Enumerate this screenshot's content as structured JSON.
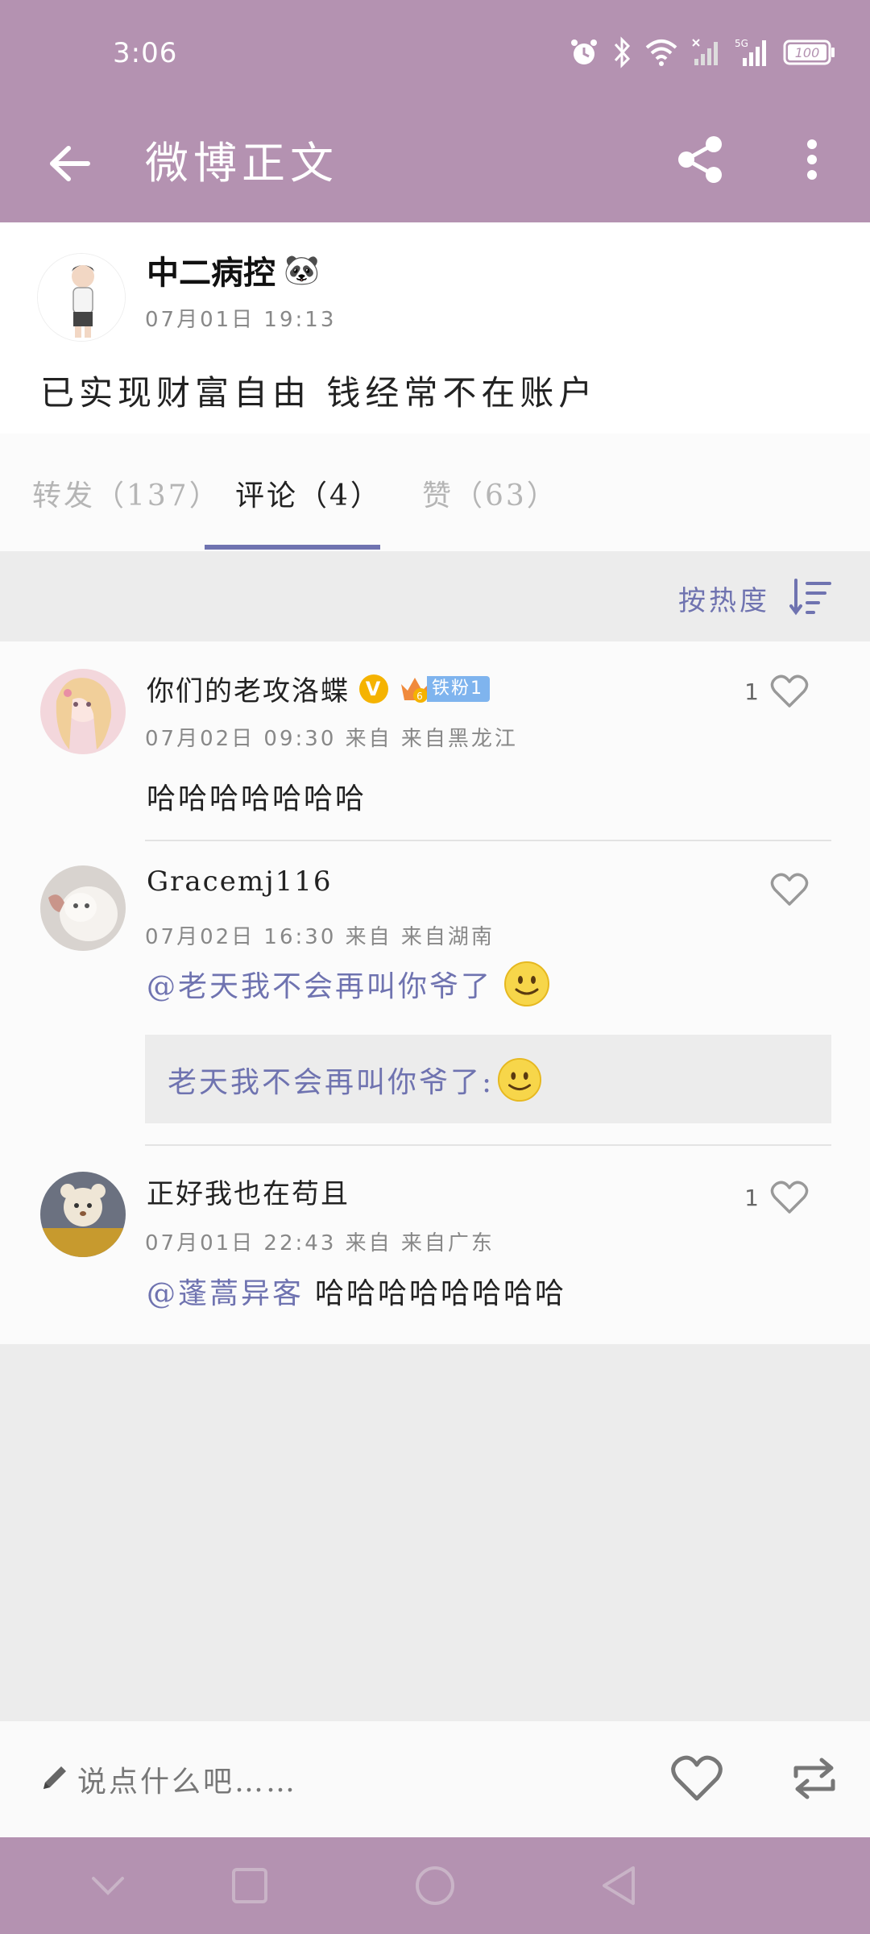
{
  "status_bar": {
    "time": "3:06",
    "battery": "100",
    "network": "5G"
  },
  "app_bar": {
    "title": "微博正文",
    "back_icon": "arrow-left-icon",
    "share_icon": "share-icon",
    "more_icon": "more-vert-icon"
  },
  "post": {
    "author": "中二病控",
    "author_emoji": "🐼",
    "time": "07月01日 19:13",
    "content": "已实现财富自由 钱经常不在账户"
  },
  "tabs": [
    {
      "label": "转发（137）"
    },
    {
      "label": "评论（4）"
    },
    {
      "label": "赞（63）"
    }
  ],
  "sort": {
    "label": "按热度"
  },
  "comments": [
    {
      "name": "你们的老攻洛蝶",
      "verified": "V",
      "fan_badge_level": "6",
      "fan_badge": "铁粉1",
      "meta": "07月02日 09:30 来自 来自黑龙江",
      "text": "哈哈哈哈哈哈哈",
      "likes": "1"
    },
    {
      "name": "Gracemj116",
      "meta": "07月02日 16:30 来自 来自湖南",
      "mention": "@老天我不会再叫你爷了",
      "quote": "老天我不会再叫你爷了:",
      "likes": ""
    },
    {
      "name": "正好我也在苟且",
      "meta": "07月01日 22:43 来自 来自广东",
      "mention": "@蓬蒿异客",
      "text": "哈哈哈哈哈哈哈哈",
      "likes": "1"
    }
  ],
  "input_bar": {
    "placeholder": "说点什么吧……"
  },
  "colors": {
    "theme": "#b492b1",
    "accent": "#6f73b0",
    "background": "#ececec"
  }
}
